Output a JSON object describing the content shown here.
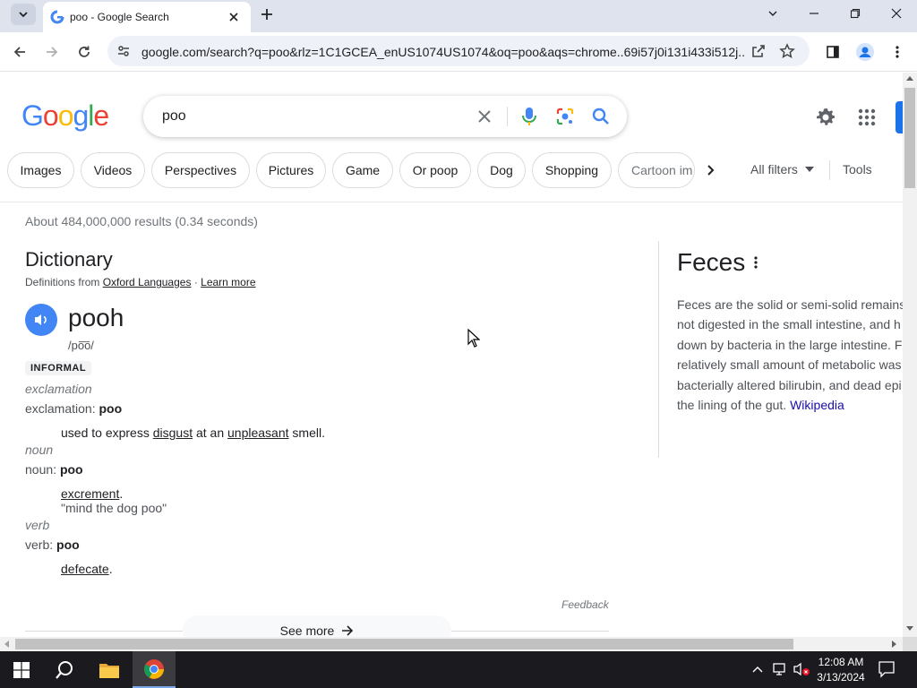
{
  "browser": {
    "tab_title": "poo - Google Search",
    "url": "google.com/search?q=poo&rlz=1C1GCEA_enUS1074US1074&oq=poo&aqs=chrome..69i57j0i131i433i512j..."
  },
  "search": {
    "query": "poo",
    "logo_letters": [
      "G",
      "o",
      "o",
      "g",
      "l",
      "e"
    ]
  },
  "chips": [
    "Images",
    "Videos",
    "Perspectives",
    "Pictures",
    "Game",
    "Or poop",
    "Dog",
    "Shopping",
    "Cartoon im"
  ],
  "filters": {
    "all_filters": "All filters",
    "tools": "Tools"
  },
  "results_stats": "About 484,000,000 results (0.34 seconds)",
  "dictionary": {
    "heading": "Dictionary",
    "definitions_from": "Definitions from",
    "source": "Oxford Languages",
    "dot": "·",
    "learn_more": "Learn more",
    "word": "pooh",
    "pronunciation": "/po͞o/",
    "register": "INFORMAL",
    "entries": [
      {
        "pos": "exclamation",
        "label": "exclamation:",
        "word": "poo",
        "def_parts": [
          "used to express ",
          "disgust",
          " at an ",
          "unpleasant",
          " smell."
        ]
      },
      {
        "pos": "noun",
        "label": "noun:",
        "word": "poo",
        "def_link": "excrement",
        "def_tail": ".",
        "example": "\"mind the dog poo\""
      },
      {
        "pos": "verb",
        "label": "verb:",
        "word": "poo",
        "def_link": "defecate",
        "def_tail": "."
      }
    ],
    "feedback": "Feedback",
    "see_more": "See more"
  },
  "knowledge_panel": {
    "title": "Feces",
    "lines": [
      "Feces are the solid or semi-solid remains",
      "not digested in the small intestine, and h",
      "down by bacteria in the large intestine. F",
      "relatively small amount of metabolic was",
      "bacterially altered bilirubin, and dead epi"
    ],
    "last_line": "the lining of the gut.",
    "source_link": "Wikipedia"
  },
  "taskbar": {
    "time": "12:08 AM",
    "date": "3/13/2024"
  },
  "colors": {
    "google_blue": "#4285f4",
    "google_red": "#ea4335",
    "google_yellow": "#fbbc05",
    "google_green": "#34a853",
    "link": "#1a0dab",
    "taskbar": "#1b1b1f"
  }
}
